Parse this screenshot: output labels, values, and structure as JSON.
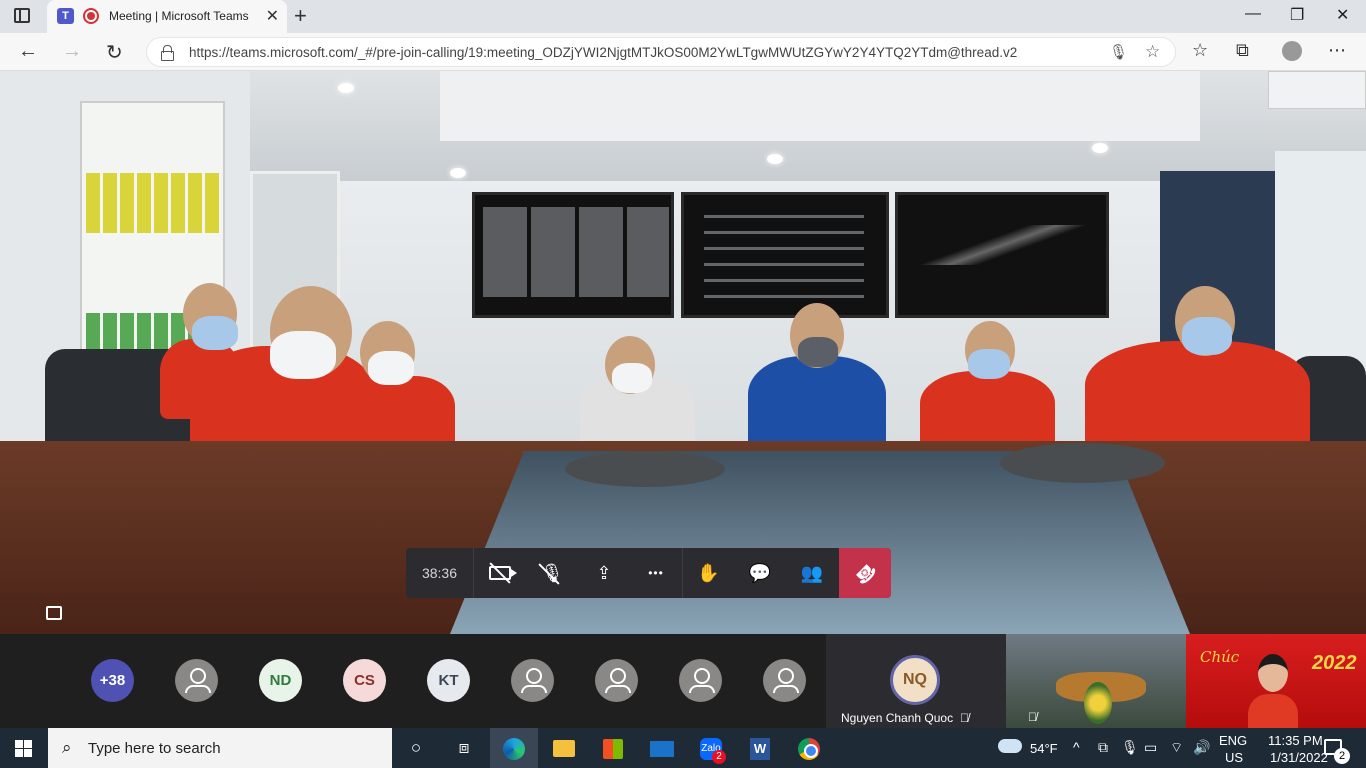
{
  "browser": {
    "tab_title": "Meeting | Microsoft Teams",
    "tab_close": "✕",
    "new_tab": "+",
    "url": "https://teams.microsoft.com/_#/pre-join-calling/19:meeting_ODZjYWI2NjgtMTJkOS00M2YwLTgwMWUtZGYwY2Y4YTQ2YTdm@thread.v2",
    "window_controls": {
      "minimize": "—",
      "maximize": "❐",
      "close": "✕"
    },
    "nav": {
      "back": "←",
      "forward": "→",
      "refresh": "↻"
    },
    "toolbar_icons": {
      "favorites": "☆",
      "collections": "⧉",
      "more": "⋯"
    }
  },
  "meeting": {
    "timer": "38:36",
    "controls": [
      {
        "name": "camera-off-button",
        "icon": "camera-off-icon"
      },
      {
        "name": "mic-off-button",
        "icon": "mic-off-icon"
      },
      {
        "name": "share-button",
        "icon": "share-icon",
        "glyph": "⇪"
      },
      {
        "name": "more-actions-button",
        "icon": "more-icon",
        "glyph": "•••"
      },
      {
        "name": "raise-hand-button",
        "icon": "hand-icon",
        "glyph": "✋"
      },
      {
        "name": "chat-button",
        "icon": "chat-icon",
        "glyph": "💬"
      },
      {
        "name": "participants-button",
        "icon": "people-icon",
        "glyph": "👥"
      },
      {
        "name": "hangup-button",
        "icon": "phone-hangup-icon",
        "glyph": "☎"
      }
    ],
    "hangup_color": "#c4314b"
  },
  "participants": {
    "more_count": "+38",
    "avatars": [
      {
        "type": "generic",
        "initials": ""
      },
      {
        "type": "initials",
        "initials": "ND",
        "bg": "#e8f4ea",
        "fg": "#2f7a3f"
      },
      {
        "type": "initials",
        "initials": "CS",
        "bg": "#f6dada",
        "fg": "#8a2f2f"
      },
      {
        "type": "initials",
        "initials": "KT",
        "bg": "#e6e9ee",
        "fg": "#3c4656"
      },
      {
        "type": "generic",
        "initials": ""
      },
      {
        "type": "generic",
        "initials": ""
      },
      {
        "type": "generic",
        "initials": ""
      },
      {
        "type": "generic",
        "initials": ""
      }
    ],
    "speaker_tile": {
      "initials": "NQ",
      "name": "Nguyen Chanh Quoc"
    },
    "video_tile_tet": {
      "greeting": "Chúc",
      "year": "2022"
    }
  },
  "taskbar": {
    "search_placeholder": "Type here to search",
    "weather": "54°F",
    "language": "ENG",
    "region": "US",
    "time": "11:35 PM",
    "date": "1/31/2022",
    "zalo_badge": "2",
    "notification_count": "2"
  }
}
